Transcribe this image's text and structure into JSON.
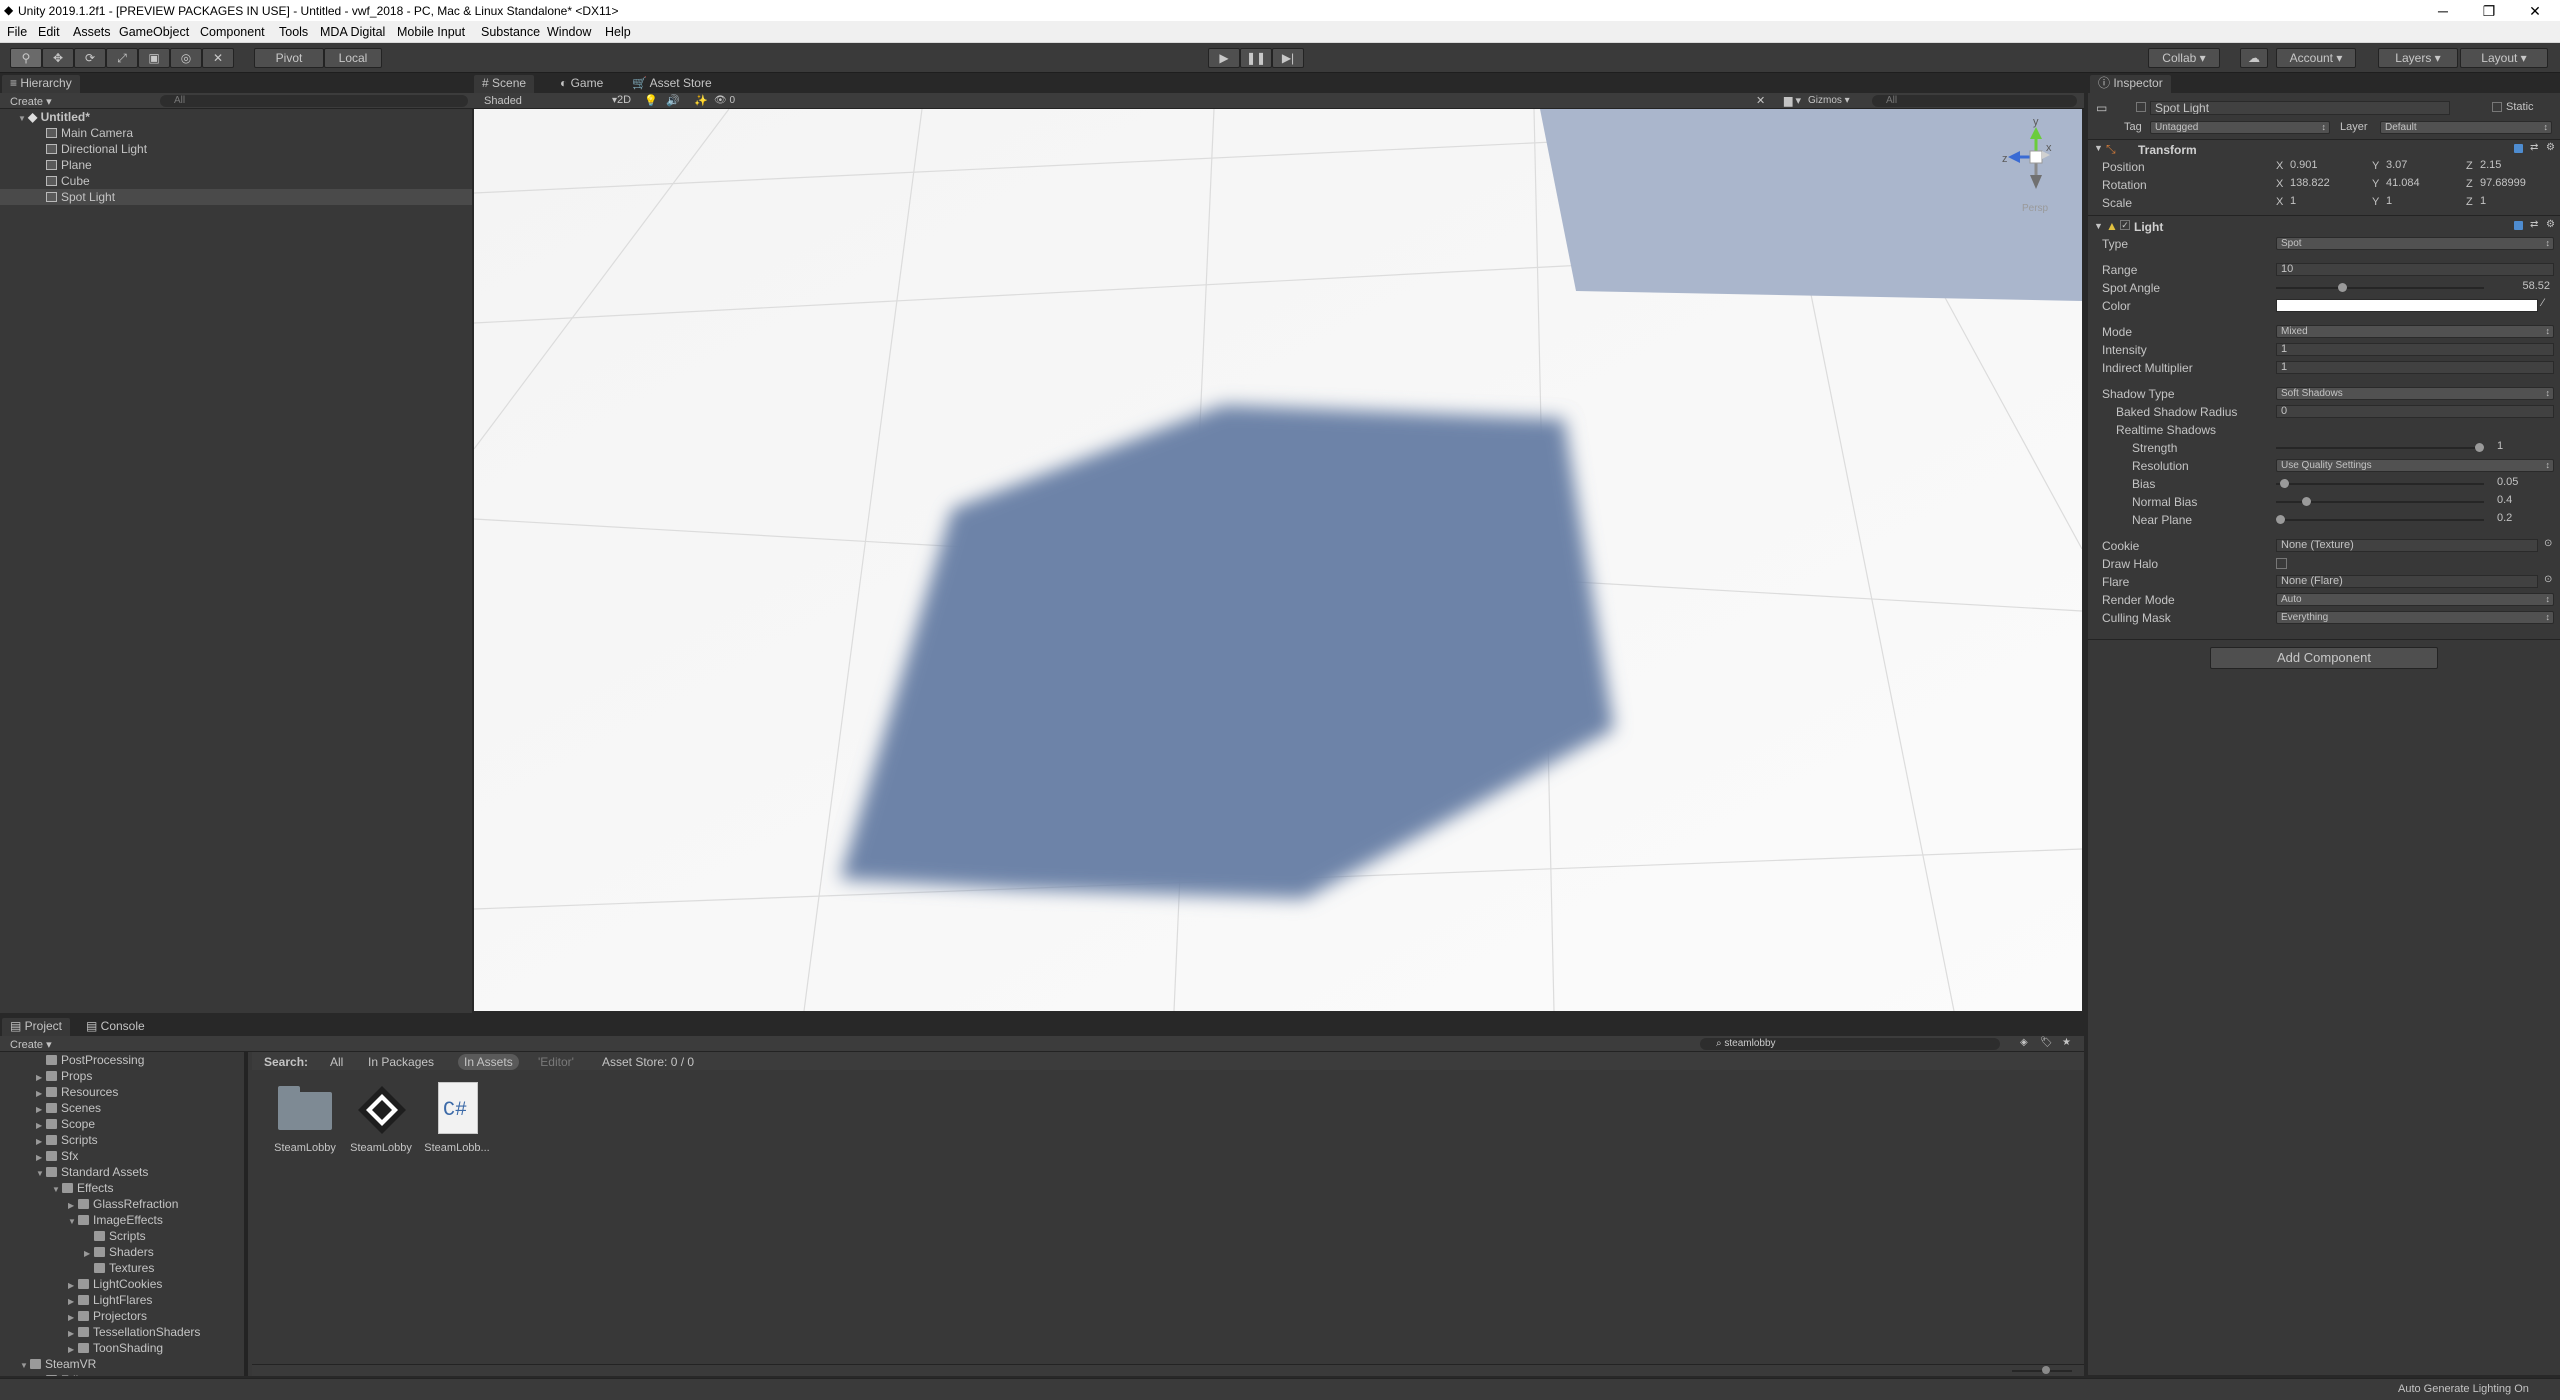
{
  "titlebar": {
    "title": "Unity 2019.1.2f1 - [PREVIEW PACKAGES IN USE] - Untitled - vwf_2018 - PC, Mac & Linux Standalone* <DX11>",
    "minimize": "─",
    "restore": "❐",
    "close": "✕"
  },
  "menubar": [
    "File",
    "Edit",
    "Assets",
    "GameObject",
    "Component",
    "Tools",
    "MDA Digital",
    "Mobile Input",
    "Substance",
    "Window",
    "Help"
  ],
  "toolbar": {
    "pivot": "Pivot",
    "local": "Local",
    "collab": "Collab",
    "account": "Account",
    "layers": "Layers",
    "layout": "Layout"
  },
  "hierarchy": {
    "tab": "Hierarchy",
    "create": "Create",
    "search_placeholder": "All",
    "scene": "Untitled*",
    "items": [
      "Main Camera",
      "Directional Light",
      "Plane",
      "Cube",
      "Spot Light"
    ]
  },
  "scene": {
    "tabs": [
      "Scene",
      "Game",
      "Asset Store"
    ],
    "shading": "Shaded",
    "mode2d": "2D",
    "gizmos": "Gizmos",
    "search_placeholder": "All",
    "hidden_count": "0",
    "persp": "Persp",
    "axis_y": "y",
    "axis_x": "x",
    "axis_z": "z"
  },
  "inspector": {
    "tab": "Inspector",
    "object_name": "Spot Light",
    "static": "Static",
    "tag_label": "Tag",
    "tag": "Untagged",
    "layer_label": "Layer",
    "layer": "Default",
    "transform": {
      "title": "Transform",
      "position_label": "Position",
      "rotation_label": "Rotation",
      "scale_label": "Scale",
      "position": [
        "0.901",
        "3.07",
        "2.15"
      ],
      "rotation": [
        "138.822",
        "41.084",
        "97.68999"
      ],
      "scale": [
        "1",
        "1",
        "1"
      ]
    },
    "light": {
      "title": "Light",
      "type_label": "Type",
      "type": "Spot",
      "range_label": "Range",
      "range": "10",
      "spot_angle_label": "Spot Angle",
      "spot_angle": "58.52",
      "spot_angle_fraction": 0.31,
      "color_label": "Color",
      "color": "#ffffff",
      "mode_label": "Mode",
      "mode": "Mixed",
      "intensity_label": "Intensity",
      "intensity": "1",
      "indirect_label": "Indirect Multiplier",
      "indirect": "1",
      "shadow_type_label": "Shadow Type",
      "shadow_type": "Soft Shadows",
      "baked_radius_label": "Baked Shadow Radius",
      "baked_radius": "0",
      "realtime_label": "Realtime Shadows",
      "strength_label": "Strength",
      "strength": "1",
      "strength_fraction": 1.0,
      "resolution_label": "Resolution",
      "resolution": "Use Quality Settings",
      "bias_label": "Bias",
      "bias": "0.05",
      "bias_fraction": 0.02,
      "normal_bias_label": "Normal Bias",
      "normal_bias": "0.4",
      "normal_bias_fraction": 0.13,
      "near_plane_label": "Near Plane",
      "near_plane": "0.2",
      "near_plane_fraction": 0.0,
      "cookie_label": "Cookie",
      "cookie": "None (Texture)",
      "draw_halo_label": "Draw Halo",
      "flare_label": "Flare",
      "flare": "None (Flare)",
      "render_mode_label": "Render Mode",
      "render_mode": "Auto",
      "culling_label": "Culling Mask",
      "culling": "Everything"
    },
    "add_component": "Add Component"
  },
  "project": {
    "tabs": [
      "Project",
      "Console"
    ],
    "create": "Create",
    "search_value": "steamlobby",
    "search_label": "Search:",
    "filters": [
      "All",
      "In Packages",
      "In Assets",
      "'Editor'",
      "Asset Store: 0 / 0"
    ],
    "tree": [
      {
        "label": "PostProcessing",
        "depth": 1,
        "arrow": ""
      },
      {
        "label": "Props",
        "depth": 1,
        "arrow": "▶"
      },
      {
        "label": "Resources",
        "depth": 1,
        "arrow": "▶"
      },
      {
        "label": "Scenes",
        "depth": 1,
        "arrow": "▶"
      },
      {
        "label": "Scope",
        "depth": 1,
        "arrow": "▶"
      },
      {
        "label": "Scripts",
        "depth": 1,
        "arrow": "▶"
      },
      {
        "label": "Sfx",
        "depth": 1,
        "arrow": "▶"
      },
      {
        "label": "Standard Assets",
        "depth": 1,
        "arrow": "▼"
      },
      {
        "label": "Effects",
        "depth": 2,
        "arrow": "▼"
      },
      {
        "label": "GlassRefraction",
        "depth": 3,
        "arrow": "▶"
      },
      {
        "label": "ImageEffects",
        "depth": 3,
        "arrow": "▼"
      },
      {
        "label": "Scripts",
        "depth": 4,
        "arrow": ""
      },
      {
        "label": "Shaders",
        "depth": 4,
        "arrow": "▶"
      },
      {
        "label": "Textures",
        "depth": 4,
        "arrow": ""
      },
      {
        "label": "LightCookies",
        "depth": 3,
        "arrow": "▶"
      },
      {
        "label": "LightFlares",
        "depth": 3,
        "arrow": "▶"
      },
      {
        "label": "Projectors",
        "depth": 3,
        "arrow": "▶"
      },
      {
        "label": "TessellationShaders",
        "depth": 3,
        "arrow": "▶"
      },
      {
        "label": "ToonShading",
        "depth": 3,
        "arrow": "▶"
      },
      {
        "label": "SteamVR",
        "depth": 0,
        "arrow": "▼"
      },
      {
        "label": "Editor",
        "depth": 1,
        "arrow": ""
      }
    ],
    "assets": [
      {
        "name": "SteamLobby",
        "icon": "folder-icon"
      },
      {
        "name": "SteamLobby",
        "icon": "unity-scene-icon"
      },
      {
        "name": "SteamLobb...",
        "icon": "csharp-script-icon"
      }
    ],
    "csharp": "C#"
  },
  "statusbar": {
    "text": "Auto Generate Lighting On"
  }
}
